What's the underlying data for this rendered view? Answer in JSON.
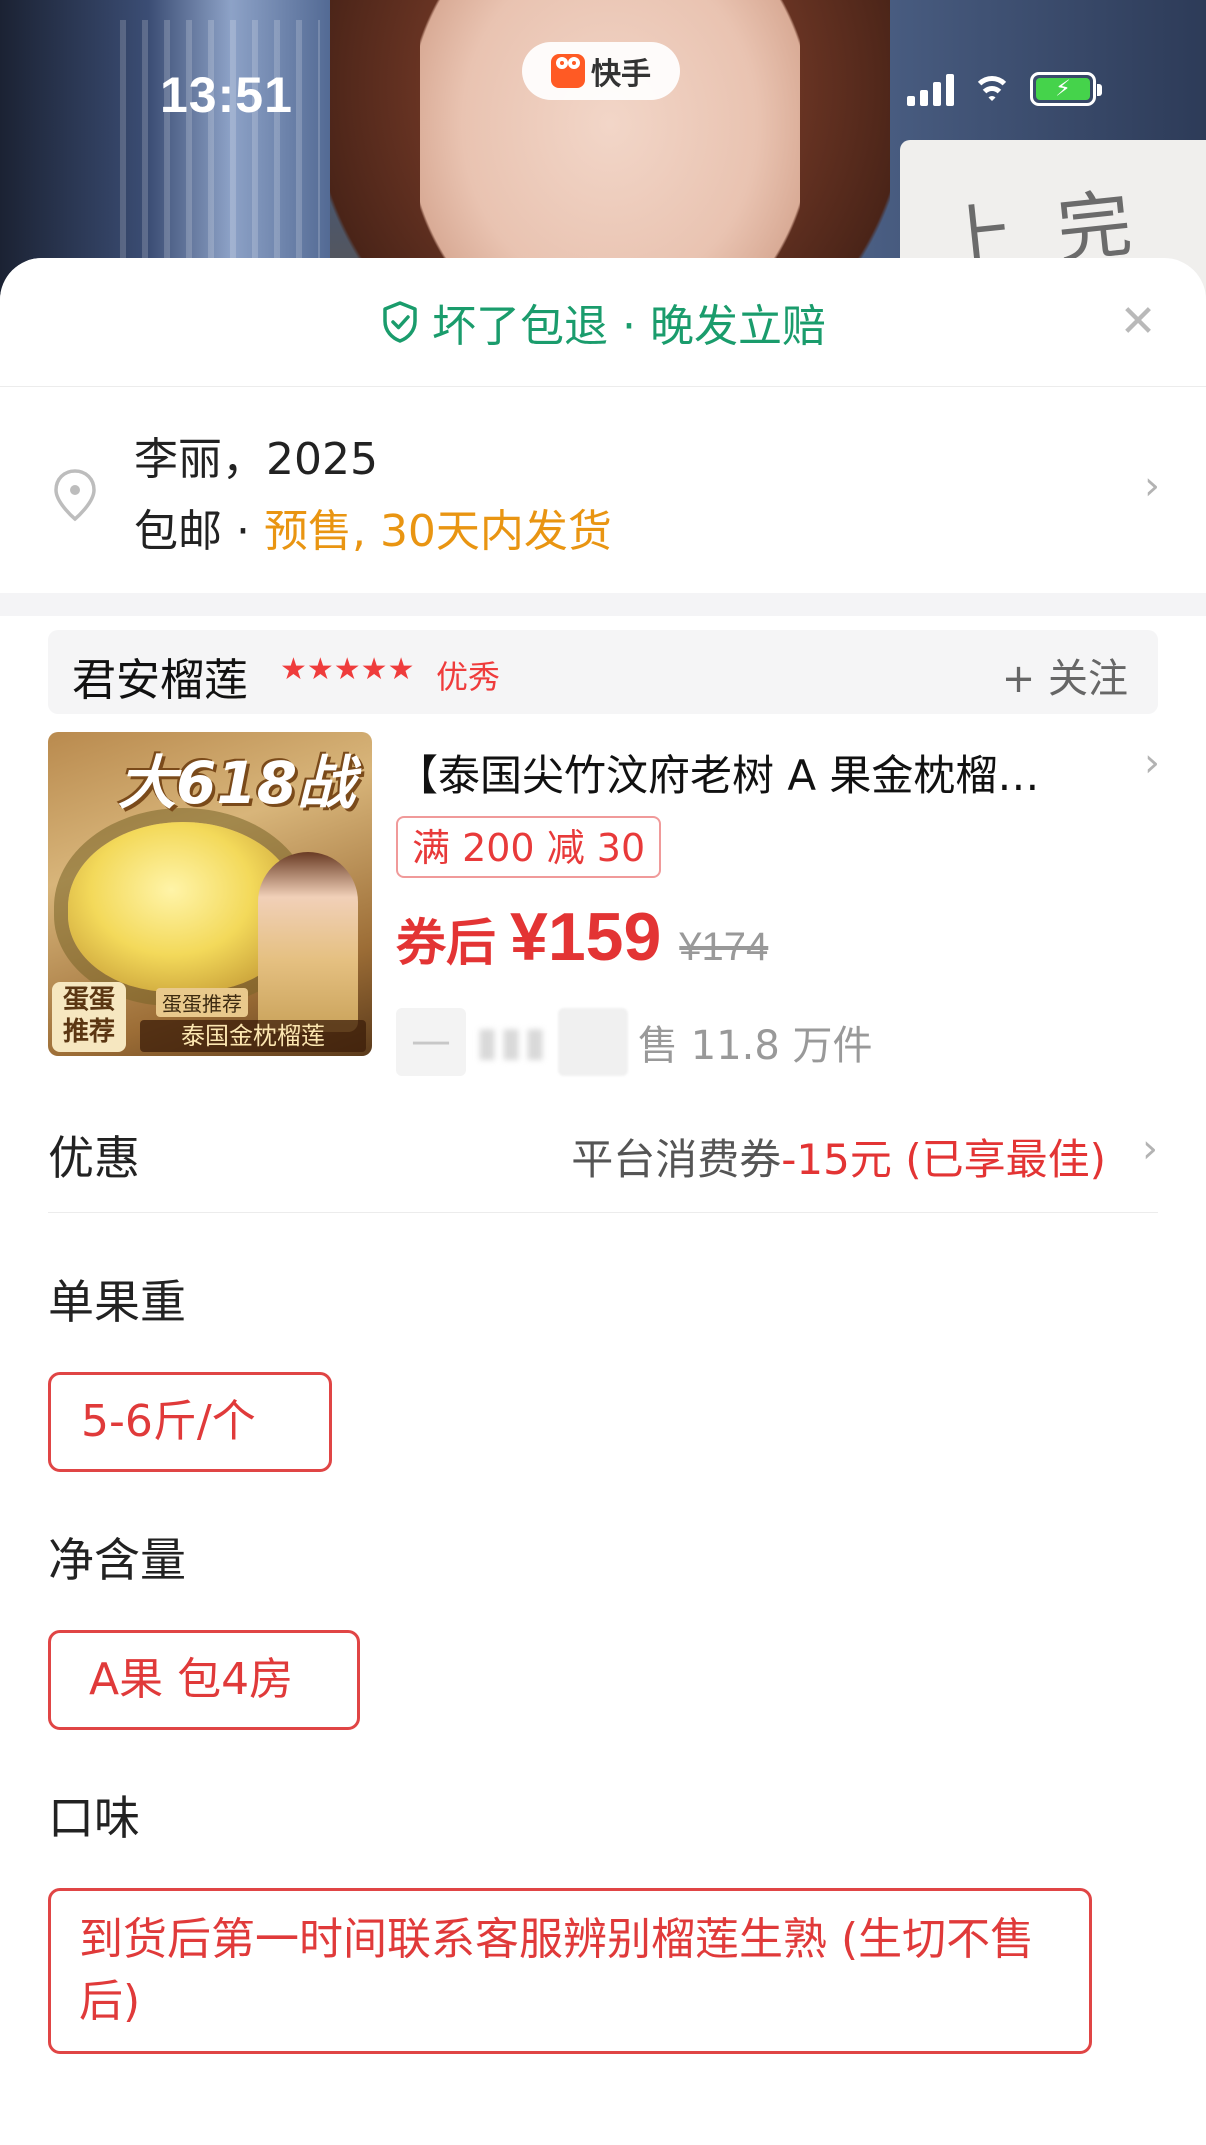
{
  "status_bar": {
    "time": "13:51",
    "app_name": "快手"
  },
  "stream_bg": {
    "whiteboard_text": "上 完 予"
  },
  "sheet": {
    "guarantee": {
      "shield_icon": "shield-check-icon",
      "text": "坏了包退 · 晚发立赔",
      "color": "#1a9c6c"
    },
    "address": {
      "line1": "李丽，2025",
      "shipping_free": "包邮",
      "separator": " · ",
      "presale": "预售, 30天内发货"
    },
    "shop": {
      "name": "君安榴莲",
      "stars": "★★★★★",
      "rating_label": "优秀",
      "follow_label": "+ 关注"
    },
    "product": {
      "image": {
        "burst_text": "大618战",
        "rec_badge": "蛋蛋推荐",
        "rec_badge_line1": "蛋蛋",
        "rec_badge_line2": "推荐",
        "rec_sub": "蛋蛋推荐",
        "img_name": "泰国金枕榴莲"
      },
      "title": "【泰国尖竹汶府老树 A 果金枕榴…",
      "promo_tag": "满 200 减 30",
      "price_label": "券后",
      "price": "¥159",
      "original_price": "¥174",
      "stepper_minus": "—",
      "sales": "售 11.8 万件"
    },
    "discount": {
      "label": "优惠",
      "value_prefix": "平台消费券",
      "value_highlight": "-15元 (已享最佳)"
    },
    "options": [
      {
        "title": "单果重",
        "selected": "5-6斤/个"
      },
      {
        "title": "净含量",
        "selected": "A果 包4房"
      },
      {
        "title": "口味",
        "selected": "到货后第一时间联系客服辨别榴莲生熟 (生切不售后)"
      }
    ],
    "accent_color": "#e33434",
    "presale_color": "#e99512"
  }
}
